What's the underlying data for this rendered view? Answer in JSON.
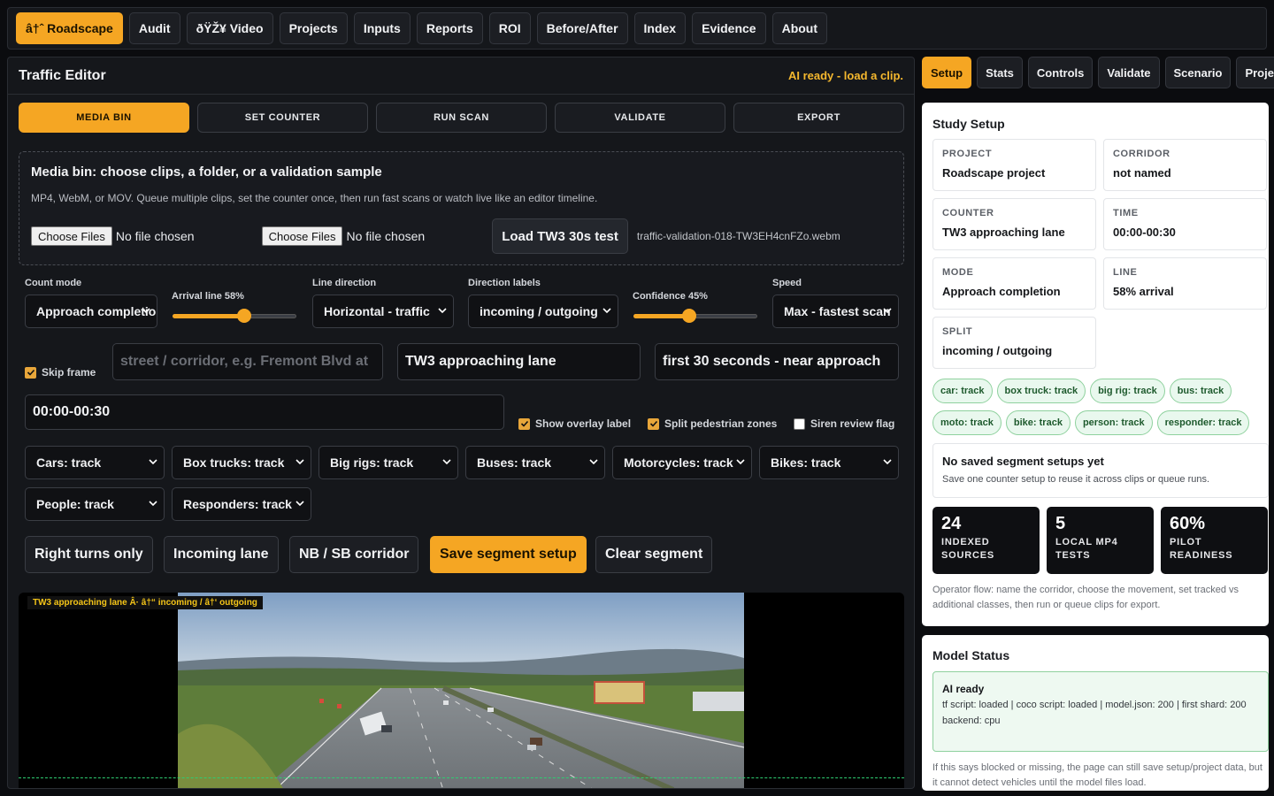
{
  "nav": {
    "items": [
      "â†ˆ Roadscape",
      "Audit",
      "ðŸŽ¥ Video",
      "Projects",
      "Inputs",
      "Reports",
      "ROI",
      "Before/After",
      "Index",
      "Evidence",
      "About"
    ]
  },
  "editor": {
    "title": "Traffic Editor",
    "ai_status": "AI ready - load a clip.",
    "tabs": [
      "MEDIA BIN",
      "SET COUNTER",
      "RUN SCAN",
      "VALIDATE",
      "EXPORT"
    ],
    "mediabin": {
      "title": "Media bin: choose clips, a folder, or a validation sample",
      "description": "MP4, WebM, or MOV. Queue multiple clips, set the counter once, then run fast scans or watch live like an editor timeline.",
      "choose_label": "Choose Files",
      "no_file": "No file chosen",
      "load_button": "Load TW3 30s test",
      "filename": "traffic-validation-018-TW3EH4cnFZo.webm"
    },
    "controls": {
      "count_mode_label": "Count mode",
      "count_mode_value": "Approach completion",
      "arrival_label": "Arrival line 58%",
      "arrival_value": 0.58,
      "line_direction_label": "Line direction",
      "line_direction_value": "Horizontal - traffic",
      "direction_labels_label": "Direction labels",
      "direction_labels_value": "incoming / outgoing",
      "confidence_label": "Confidence 45%",
      "confidence_value": 0.45,
      "speed_label": "Speed",
      "speed_value": "Max - fastest scan",
      "skip_frame": "Skip frame",
      "street_placeholder": "street / corridor, e.g. Fremont Blvd at",
      "counter_name": "TW3 approaching lane",
      "segment_note": "first 30 seconds - near approach",
      "time_range": "00:00-00:30",
      "show_overlay": "Show overlay label",
      "split_ped": "Split pedestrian zones",
      "siren": "Siren review flag"
    },
    "classes": [
      "Cars: track",
      "Box trucks: track",
      "Big rigs: track",
      "Buses: track",
      "Motorcycles: track",
      "Bikes: track",
      "People: track",
      "Responders: track"
    ],
    "actions": [
      "Right turns only",
      "Incoming lane",
      "NB / SB corridor",
      "Save segment setup",
      "Clear segment"
    ],
    "video": {
      "overlay_label": "TW3 approaching lane Â· â†“ incoming / â†‘ outgoing"
    }
  },
  "side": {
    "tabs": [
      "Setup",
      "Stats",
      "Controls",
      "Validate",
      "Scenario",
      "Projects"
    ],
    "study": {
      "title": "Study Setup",
      "fields": [
        {
          "k": "PROJECT",
          "v": "Roadscape project"
        },
        {
          "k": "CORRIDOR",
          "v": "not named"
        },
        {
          "k": "COUNTER",
          "v": "TW3 approaching lane"
        },
        {
          "k": "TIME",
          "v": "00:00-00:30"
        },
        {
          "k": "MODE",
          "v": "Approach completion"
        },
        {
          "k": "LINE",
          "v": "58% arrival"
        },
        {
          "k": "SPLIT",
          "v": "incoming / outgoing"
        }
      ],
      "chips": [
        "car: track",
        "box truck: track",
        "big rig: track",
        "bus: track",
        "moto: track",
        "bike: track",
        "person: track",
        "responder: track"
      ],
      "saved_title": "No saved segment setups yet",
      "saved_desc": "Save one counter setup to reuse it across clips or queue runs.",
      "stats": [
        {
          "n": "24",
          "l1": "INDEXED",
          "l2": "SOURCES"
        },
        {
          "n": "5",
          "l1": "LOCAL MP4",
          "l2": "TESTS"
        },
        {
          "n": "60%",
          "l1": "PILOT",
          "l2": "READINESS"
        }
      ],
      "opflow": "Operator flow: name the corridor, choose the movement, set tracked vs additional classes, then run or queue clips for export."
    },
    "model": {
      "title": "Model Status",
      "status": "AI ready",
      "detail": "tf script: loaded | coco script: loaded | model.json: 200 | first shard: 200",
      "backend": "backend: cpu",
      "note": "If this says blocked or missing, the page can still save setup/project data, but it cannot detect vehicles until the model files load."
    }
  },
  "colors": {
    "accent": "#f5a623",
    "panel": "#15171b",
    "chip_green": "#e9f8ee"
  }
}
